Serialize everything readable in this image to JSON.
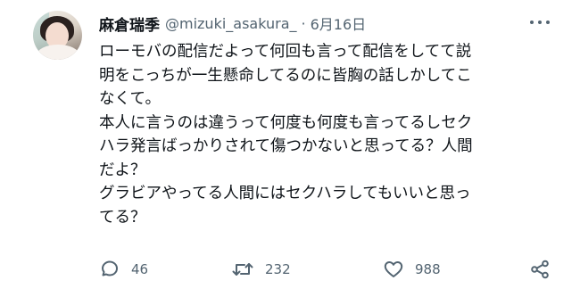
{
  "author": {
    "name": "麻倉瑞季",
    "handle": "@mizuki_asakura_",
    "separator": "·",
    "date": "6月16日"
  },
  "body": {
    "lines": [
      "ローモバの配信だよって何回も言って配信をしてて説",
      "明をこっちが一生懸命してるのに皆胸の話しかしてこ",
      "なくて。",
      "本人に言うのは違うって何度も何度も言ってるしセク",
      "ハラ発言ばっかりされて傷つかないと思ってる？人間",
      "だよ？",
      "グラビアやってる人間にはセクハラしてもいいと思っ",
      "てる？"
    ]
  },
  "actions": {
    "reply_count": "46",
    "retweet_count": "232",
    "like_count": "988"
  },
  "icons": {
    "reply": "reply-icon",
    "retweet": "retweet-icon",
    "like": "heart-icon",
    "share": "share-icon",
    "more": "more-icon"
  },
  "colors": {
    "text": "#0f1419",
    "secondary": "#536471",
    "background": "#ffffff"
  }
}
